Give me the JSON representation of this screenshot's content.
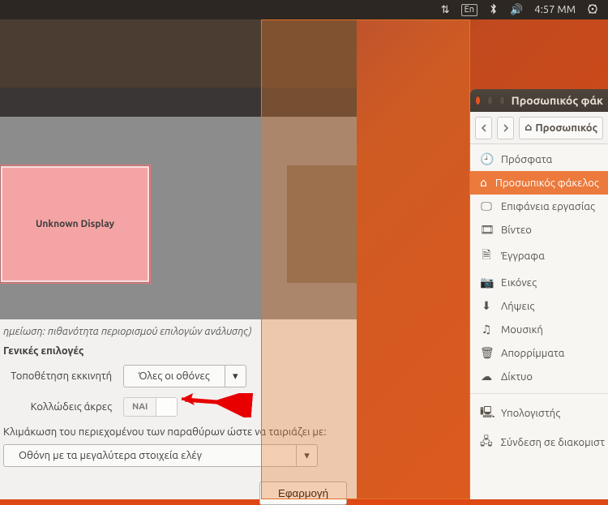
{
  "menubar": {
    "lang_indicator": "En",
    "time": "4:57 ΜΜ"
  },
  "settings": {
    "display_label": "Unknown Display",
    "note": "ημείωση: πιθανότητα περιορισμού επιλογών ανάλυσης)",
    "section_title": "Γενικές επιλογές",
    "launcher_label": "Τοποθέτηση εκκινητή",
    "launcher_value": "Όλες οι οθόνες",
    "sticky_label": "Κολλώδεις άκρες",
    "sticky_value": "ΝΑΙ",
    "scaling_label": "Κλιμάκωση του περιεχομένου των παραθύρων ώστε να ταιριάζει με:",
    "scaling_value": "Οθόνη με τα μεγαλύτερα στοιχεία ελέγ",
    "apply_label": "Εφαρμογή"
  },
  "files": {
    "title": "Προσωπικός φάκ",
    "breadcrumb": "Προσωπικός",
    "items": [
      {
        "icon": "🕘",
        "label": "Πρόσφατα",
        "name": "recent"
      },
      {
        "icon": "⌂",
        "label": "Προσωπικός φάκελος",
        "name": "home",
        "active": true
      },
      {
        "icon": "🖵",
        "label": "Επιφάνεια εργασίας",
        "name": "desktop"
      },
      {
        "icon": "🎞",
        "label": "Βίντεο",
        "name": "videos"
      },
      {
        "icon": "🗎",
        "label": "Έγγραφα",
        "name": "documents"
      },
      {
        "icon": "📷",
        "label": "Εικόνες",
        "name": "pictures"
      },
      {
        "icon": "⬇",
        "label": "Λήψεις",
        "name": "downloads"
      },
      {
        "icon": "♫",
        "label": "Μουσική",
        "name": "music"
      },
      {
        "icon": "🗑",
        "label": "Απορρίμματα",
        "name": "trash"
      },
      {
        "icon": "☁",
        "label": "Δίκτυο",
        "name": "network"
      }
    ],
    "devices": [
      {
        "icon": "🖳",
        "label": "Υπολογιστής",
        "name": "computer"
      },
      {
        "icon": "🖧",
        "label": "Σύνδεση σε διακομιστ",
        "name": "connect-server"
      }
    ]
  }
}
